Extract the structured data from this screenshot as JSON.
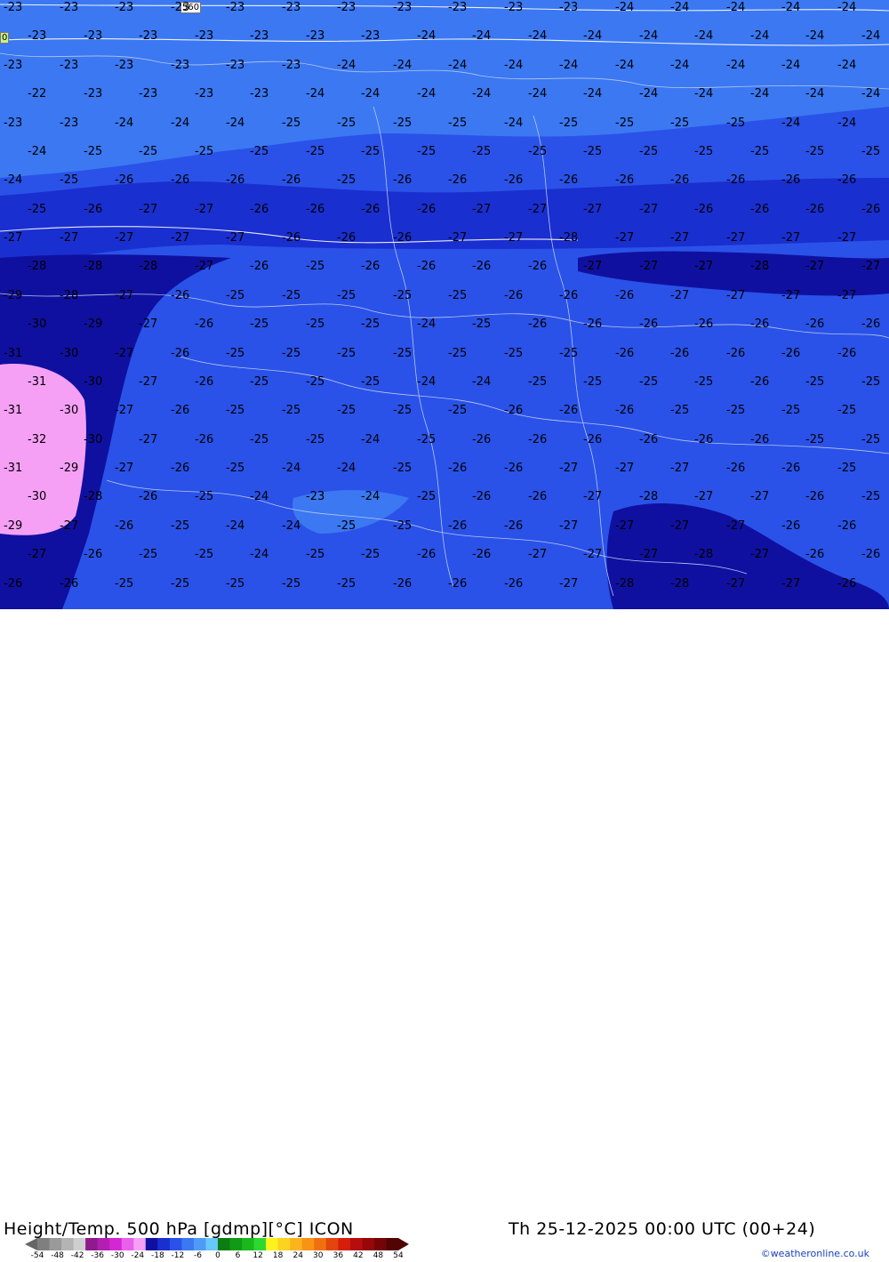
{
  "title": "Height/Temp. 500 hPa [gdmp][°C] ICON",
  "datetime": "Th 25-12-2025 00:00 UTC (00+24)",
  "credit": "©weatheronline.co.uk",
  "contour_labels": [
    "560",
    "0"
  ],
  "colorbar": {
    "ticks": [
      "-54",
      "-48",
      "-42",
      "-36",
      "-30",
      "-24",
      "-18",
      "-12",
      "-6",
      "0",
      "6",
      "12",
      "18",
      "24",
      "30",
      "36",
      "42",
      "48",
      "54"
    ],
    "colors": [
      "#7f7f7f",
      "#9a9a9a",
      "#b4b4b4",
      "#cfcfcf",
      "#8e1a8e",
      "#b21fb2",
      "#d427d4",
      "#ea60ea",
      "#f5a0f5",
      "#1010a0",
      "#1a2fd0",
      "#2a52e8",
      "#3b78f2",
      "#4d9bf6",
      "#66c8fb",
      "#0b7d12",
      "#129a16",
      "#1bb81c",
      "#2ed82f",
      "#fcf21e",
      "#fcd31e",
      "#fbb41e",
      "#f99316",
      "#f0700f",
      "#e3450c",
      "#d61e0c",
      "#b80d0d",
      "#960808",
      "#750505",
      "#520303"
    ]
  },
  "temperature_labels": [
    [
      "-23",
      "-23",
      "-23",
      "-23",
      "-23",
      "-23",
      "-23",
      "-23",
      "-23",
      "-23",
      "-23",
      "-24",
      "-24",
      "-24",
      "-24",
      "-24"
    ],
    [
      "-23",
      "-23",
      "-23",
      "-23",
      "-23",
      "-23",
      "-23",
      "-24",
      "-24",
      "-24",
      "-24",
      "-24",
      "-24",
      "-24",
      "-24",
      "-24"
    ],
    [
      "-23",
      "-23",
      "-23",
      "-23",
      "-23",
      "-23",
      "-24",
      "-24",
      "-24",
      "-24",
      "-24",
      "-24",
      "-24",
      "-24",
      "-24",
      "-24"
    ],
    [
      "-22",
      "-23",
      "-23",
      "-23",
      "-23",
      "-24",
      "-24",
      "-24",
      "-24",
      "-24",
      "-24",
      "-24",
      "-24",
      "-24",
      "-24",
      "-24"
    ],
    [
      "-23",
      "-23",
      "-24",
      "-24",
      "-24",
      "-25",
      "-25",
      "-25",
      "-25",
      "-24",
      "-25",
      "-25",
      "-25",
      "-25",
      "-24",
      "-24"
    ],
    [
      "-24",
      "-25",
      "-25",
      "-25",
      "-25",
      "-25",
      "-25",
      "-25",
      "-25",
      "-25",
      "-25",
      "-25",
      "-25",
      "-25",
      "-25",
      "-25"
    ],
    [
      "-24",
      "-25",
      "-26",
      "-26",
      "-26",
      "-26",
      "-25",
      "-26",
      "-26",
      "-26",
      "-26",
      "-26",
      "-26",
      "-26",
      "-26",
      "-26"
    ],
    [
      "-25",
      "-26",
      "-27",
      "-27",
      "-26",
      "-26",
      "-26",
      "-26",
      "-27",
      "-27",
      "-27",
      "-27",
      "-26",
      "-26",
      "-26",
      "-26"
    ],
    [
      "-27",
      "-27",
      "-27",
      "-27",
      "-27",
      "-26",
      "-26",
      "-26",
      "-27",
      "-27",
      "-28",
      "-27",
      "-27",
      "-27",
      "-27",
      "-27"
    ],
    [
      "-28",
      "-28",
      "-28",
      "-27",
      "-26",
      "-25",
      "-26",
      "-26",
      "-26",
      "-26",
      "-27",
      "-27",
      "-27",
      "-28",
      "-27",
      "-27"
    ],
    [
      "-29",
      "-28",
      "-27",
      "-26",
      "-25",
      "-25",
      "-25",
      "-25",
      "-25",
      "-26",
      "-26",
      "-26",
      "-27",
      "-27",
      "-27",
      "-27"
    ],
    [
      "-30",
      "-29",
      "-27",
      "-26",
      "-25",
      "-25",
      "-25",
      "-24",
      "-25",
      "-26",
      "-26",
      "-26",
      "-26",
      "-26",
      "-26",
      "-26"
    ],
    [
      "-31",
      "-30",
      "-27",
      "-26",
      "-25",
      "-25",
      "-25",
      "-25",
      "-25",
      "-25",
      "-25",
      "-26",
      "-26",
      "-26",
      "-26",
      "-26"
    ],
    [
      "-31",
      "-30",
      "-27",
      "-26",
      "-25",
      "-25",
      "-25",
      "-24",
      "-24",
      "-25",
      "-25",
      "-25",
      "-25",
      "-26",
      "-25",
      "-25"
    ],
    [
      "-31",
      "-30",
      "-27",
      "-26",
      "-25",
      "-25",
      "-25",
      "-25",
      "-25",
      "-26",
      "-26",
      "-26",
      "-25",
      "-25",
      "-25",
      "-25"
    ],
    [
      "-32",
      "-30",
      "-27",
      "-26",
      "-25",
      "-25",
      "-24",
      "-25",
      "-26",
      "-26",
      "-26",
      "-26",
      "-26",
      "-26",
      "-25",
      "-25"
    ],
    [
      "-31",
      "-29",
      "-27",
      "-26",
      "-25",
      "-24",
      "-24",
      "-25",
      "-26",
      "-26",
      "-27",
      "-27",
      "-27",
      "-26",
      "-26",
      "-25"
    ],
    [
      "-30",
      "-28",
      "-26",
      "-25",
      "-24",
      "-23",
      "-24",
      "-25",
      "-26",
      "-26",
      "-27",
      "-28",
      "-27",
      "-27",
      "-26",
      "-25"
    ],
    [
      "-29",
      "-27",
      "-26",
      "-25",
      "-24",
      "-24",
      "-25",
      "-25",
      "-26",
      "-26",
      "-27",
      "-27",
      "-27",
      "-27",
      "-26",
      "-26"
    ],
    [
      "-27",
      "-26",
      "-25",
      "-25",
      "-24",
      "-25",
      "-25",
      "-26",
      "-26",
      "-27",
      "-27",
      "-27",
      "-28",
      "-27",
      "-26",
      "-26"
    ],
    [
      "-26",
      "-26",
      "-25",
      "-25",
      "-25",
      "-25",
      "-25",
      "-26",
      "-26",
      "-26",
      "-27",
      "-28",
      "-28",
      "-27",
      "-27",
      "-26"
    ]
  ]
}
